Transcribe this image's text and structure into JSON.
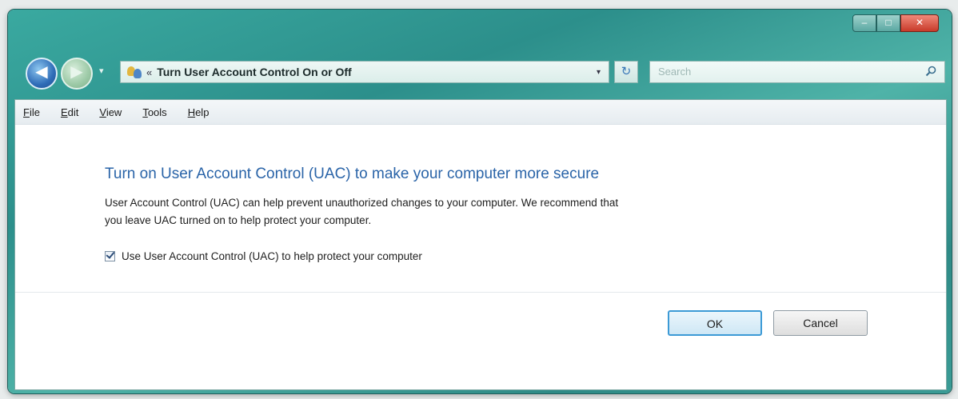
{
  "window": {
    "caption_buttons": {
      "minimize": "–",
      "maximize": "□",
      "close": "✕"
    }
  },
  "nav": {
    "back_glyph": "◀",
    "forward_glyph": "▶",
    "recent_dropdown": "▾",
    "address": {
      "separator": "«",
      "path": "Turn User Account Control On or Off",
      "dropdown": "▾"
    },
    "refresh_glyph": "↻",
    "search": {
      "placeholder": "Search"
    }
  },
  "menu": {
    "items": [
      {
        "accel": "F",
        "rest": "ile"
      },
      {
        "accel": "E",
        "rest": "dit"
      },
      {
        "accel": "V",
        "rest": "iew"
      },
      {
        "accel": "T",
        "rest": "ools"
      },
      {
        "accel": "H",
        "rest": "elp"
      }
    ]
  },
  "content": {
    "title": "Turn on User Account Control (UAC) to make your computer more secure",
    "description_line1": "User Account Control (UAC) can help prevent unauthorized changes to your computer.  We recommend that",
    "description_line2": "you leave UAC turned on to help protect your computer.",
    "checkbox": {
      "label": "Use User Account Control (UAC) to help protect your computer",
      "checked": true
    }
  },
  "buttons": {
    "ok": "OK",
    "cancel": "Cancel"
  },
  "icons": {
    "back": "back-arrow-icon",
    "forward": "forward-arrow-icon",
    "address": "users-icon",
    "refresh": "refresh-icon",
    "search": "search-icon"
  },
  "colors": {
    "frame": "#3aa9a0",
    "title_text": "#2a64a8",
    "ok_border": "#3c9ad6"
  }
}
